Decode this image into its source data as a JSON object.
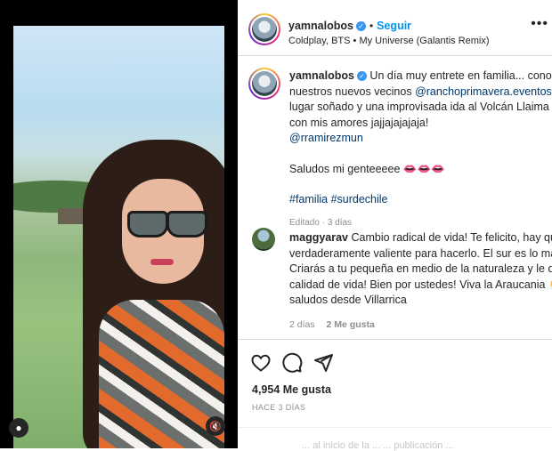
{
  "post": {
    "username": "yamnalobos",
    "follow_label": "Seguir",
    "music": "Coldplay, BTS • My Universe (Galantis Remix)",
    "caption": {
      "line1": "Un día muy entrete en familia... conocien",
      "line2_prefix": "nuestros nuevos vecinos ",
      "mention1": "@ranchoprimavera.eventos",
      "line2_suffix": " qu",
      "line3": "lugar soñado y una improvisada ida al Volcán Llaima",
      "line4": "con mis amores jajjajajajaja!",
      "mention2": "@rramirezmun",
      "greeting": "Saludos mi genteeeee",
      "hashtag1": "#familia",
      "hashtag2": "#surdechile",
      "edited": "Editado",
      "edited_time": "3 días"
    },
    "comment": {
      "username": "maggyarav",
      "lines": [
        "Cambio radical de vida! Te felicito, hay que s",
        "verdaderamente valiente para hacerlo. El sur es lo máxim",
        "Criarás a tu pequeña en medio de la naturaleza y le dara",
        "calidad de vida! Bien por ustedes! Viva la Araucania",
        "saludos desde Villarrica"
      ],
      "time": "2 días",
      "likes": "2 Me gusta"
    },
    "likes": "4,954 Me gusta",
    "posted": "HACE 3 DÍAS",
    "bottom_text": "... al inicio de la ... ... publicación ..."
  },
  "icons": {
    "heart": "heart-icon",
    "comment": "comment-icon",
    "share": "share-icon",
    "more": "more-options-icon",
    "user": "user-tag-icon",
    "mute": "mute-icon"
  },
  "colors": {
    "accent": "#0095f6",
    "link": "#00376b",
    "verified": "#3897f0"
  }
}
